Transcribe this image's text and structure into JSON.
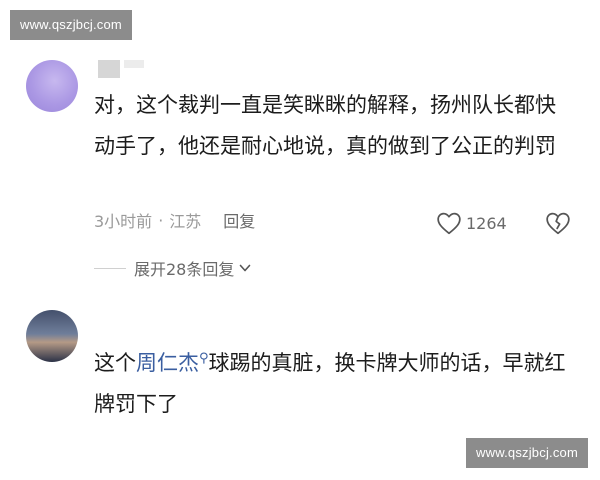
{
  "watermark": {
    "text": "www.qszjbcj.com"
  },
  "comments": [
    {
      "text": "对，这个裁判一直是笑眯眯的解释，扬州队长都快动手了，他还是耐心地说，真的做到了公正的判罚",
      "time": "3小时前",
      "location": "江苏",
      "reply_label": "回复",
      "likes": "1264",
      "expand_replies": "展开28条回复"
    },
    {
      "text_before": "这个",
      "mention": "周仁杰",
      "text_after": "球踢的真脏，换卡牌大师的话，早就红牌罚下了"
    }
  ],
  "icons": {
    "like": "heart-outline-icon",
    "dislike": "broken-heart-icon",
    "expand": "chevron-down-icon",
    "mention_search": "search-icon"
  },
  "colors": {
    "mention": "#3a5ea0",
    "meta": "#9a9a9a",
    "watermark_bg": "#8c8c8c"
  }
}
